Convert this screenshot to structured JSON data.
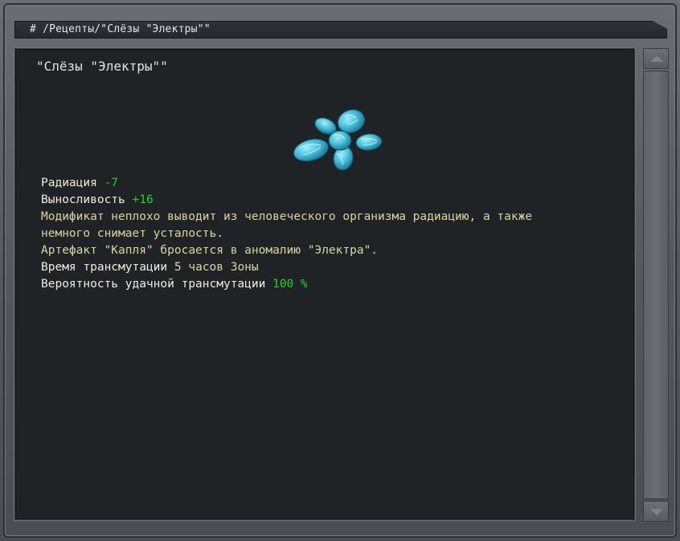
{
  "header": {
    "path": "#  /Рецепты/\"Слёзы \"Электры\"\""
  },
  "item": {
    "name": "\"Слёзы \"Электры\"\"",
    "icon": "cyan-crystal-artifact-icon"
  },
  "stats": {
    "radiation_label": "Радиация ",
    "radiation_value": "-7",
    "stamina_label": "Выносливость ",
    "stamina_value": "+16",
    "description_line1": "Модификат неплохо выводит из человеческого организма радиацию, а также",
    "description_line2": "немного снимает усталость.",
    "recipe_note": "Артефакт \"Капля\" бросается в аномалию \"Электра\".",
    "time_label": "Время трансмутации ",
    "time_value": "5 часов Зоны",
    "chance_label": "Вероятность удачной трансмутации ",
    "chance_value": "100 %"
  },
  "colors": {
    "positive": "#22d12a",
    "description": "#d9d79e",
    "text": "#eeeedc"
  }
}
